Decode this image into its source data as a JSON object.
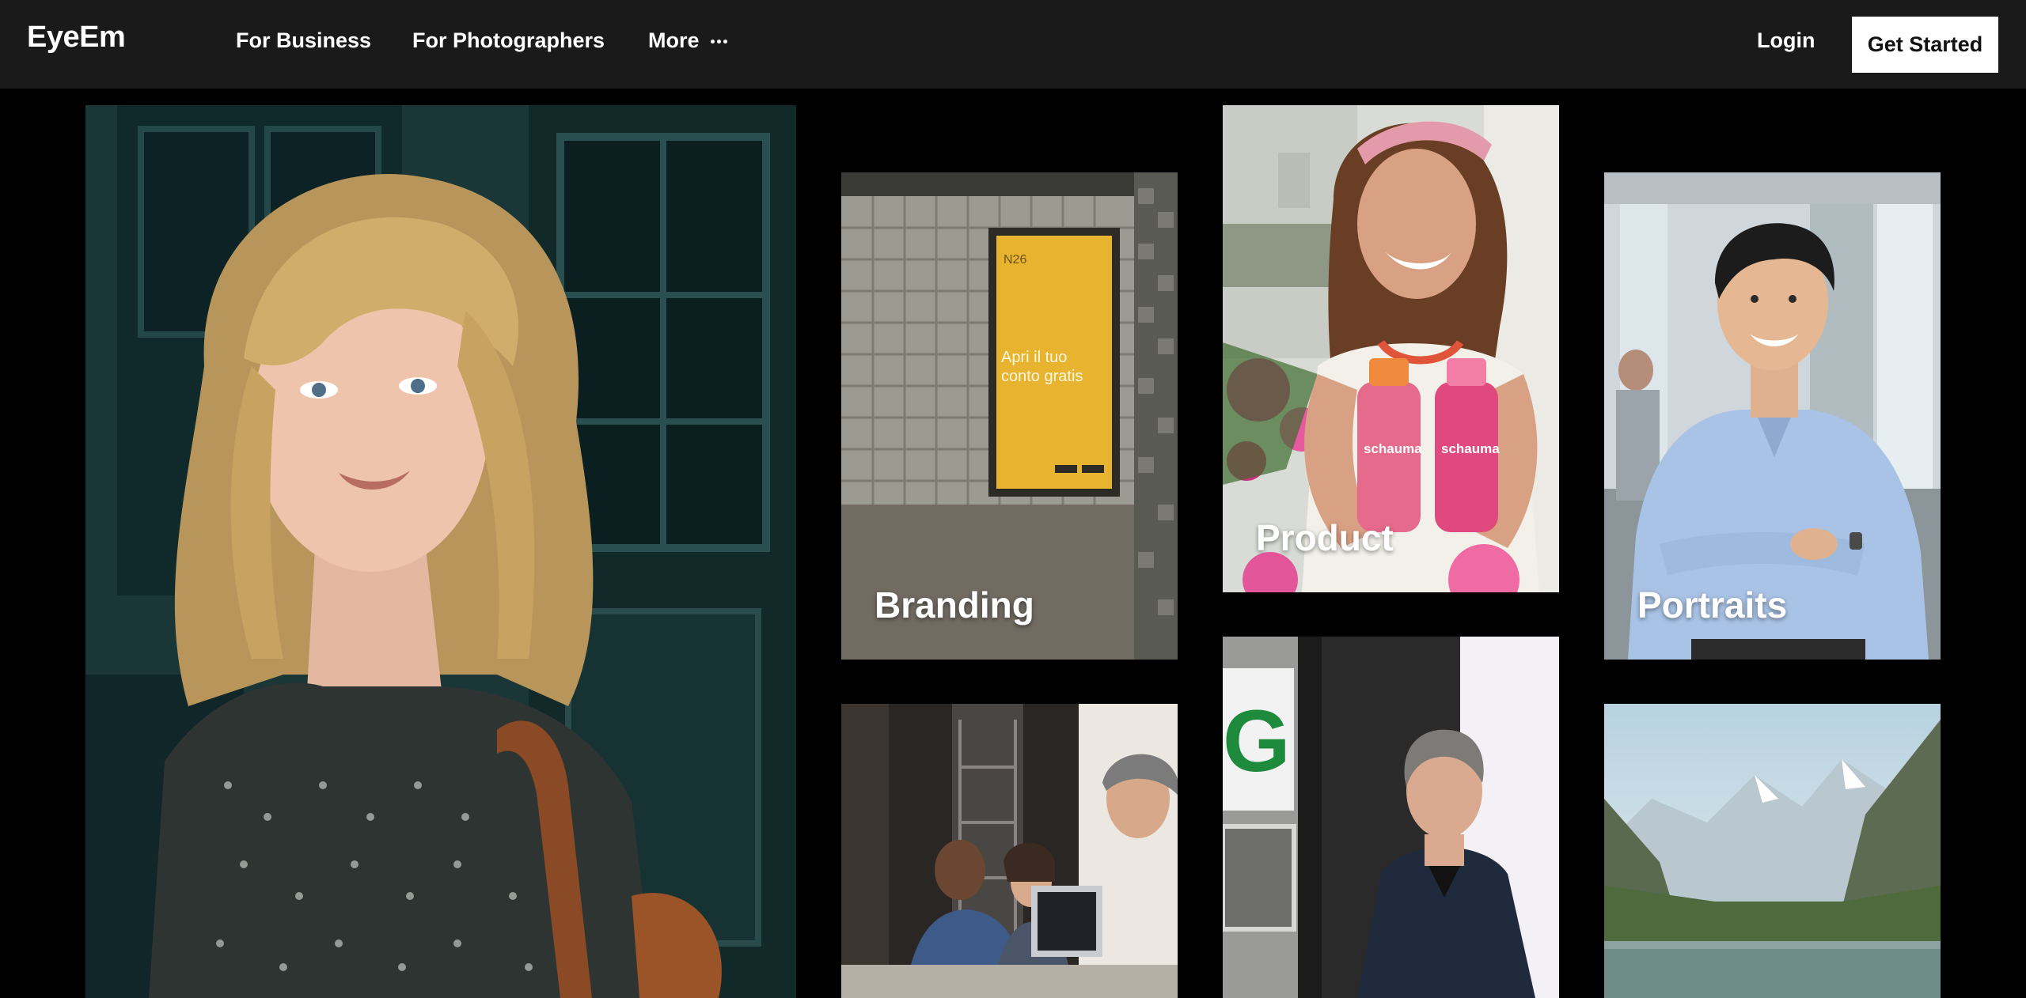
{
  "nav": {
    "logo": "EyeEm",
    "links": [
      "For Business",
      "For Photographers",
      "More"
    ],
    "more_icon": "ellipsis-icon",
    "login": "Login",
    "cta": "Get Started"
  },
  "grid": {
    "tiles": [
      {
        "label": "",
        "image": "blonde-woman-portrait"
      },
      {
        "label": "Branding",
        "image": "n26-billboard-underpass",
        "billboard_text": [
          "Apri il tuo",
          "conto gratis"
        ],
        "billboard_brand": "N26"
      },
      {
        "label": "Product",
        "image": "woman-with-schauma-bottles",
        "product_text": [
          "schauma",
          "schauma"
        ]
      },
      {
        "label": "Portraits",
        "image": "smiling-man-office"
      },
      {
        "label": "",
        "image": "office-meeting-laptop"
      },
      {
        "label": "",
        "image": "conference-speaker-stage"
      },
      {
        "label": "",
        "image": "alpine-lake-mountains"
      }
    ]
  },
  "colors": {
    "navbar": "#1a1a1a",
    "page": "#000000",
    "text": "#ffffff",
    "cta_bg": "#ffffff",
    "cta_text": "#111111"
  }
}
